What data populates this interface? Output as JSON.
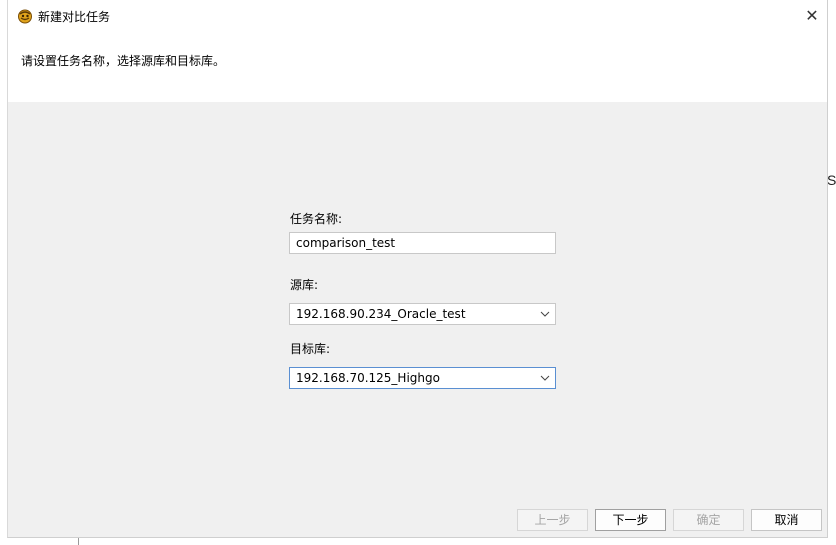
{
  "window": {
    "title": "新建对比任务",
    "close_glyph": "✕"
  },
  "header": {
    "instruction": "请设置任务名称，选择源库和目标库。"
  },
  "form": {
    "task_name_label": "任务名称:",
    "task_name_value": "comparison_test",
    "source_label": "源库:",
    "source_value": "192.168.90.234_Oracle_test",
    "target_label": "目标库:",
    "target_value": "192.168.70.125_Highgo"
  },
  "buttons": {
    "prev": "上一步",
    "next": "下一步",
    "ok": "确定",
    "cancel": "取消"
  },
  "background": {
    "partial_letter": "S"
  },
  "icons": {
    "app": "app-logo-icon",
    "close": "close-icon",
    "dropdown": "chevron-down-icon"
  },
  "colors": {
    "dialog_bg": "#f0f0f0",
    "header_bg": "#ffffff",
    "focus_border": "#5a8fd2",
    "disabled_text": "#a5a5a5"
  }
}
